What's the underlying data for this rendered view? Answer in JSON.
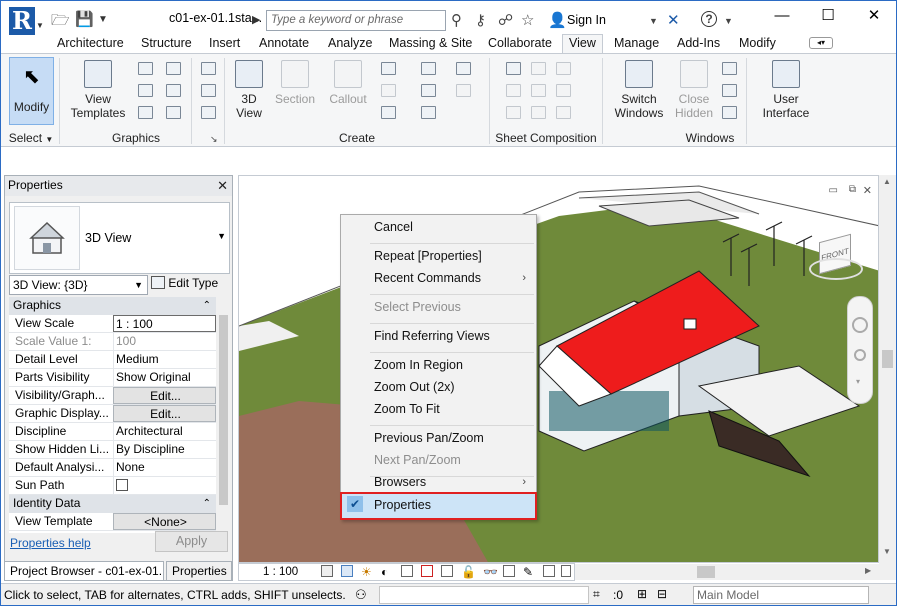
{
  "titlebar": {
    "doc_title": "c01-ex-01.1sta...",
    "search_placeholder": "Type a keyword or phrase",
    "sign_in": "Sign In",
    "help": "?",
    "minimize": "—",
    "maximize": "☐",
    "close": "✕"
  },
  "app_menu": {
    "logo": "R",
    "sub": "A"
  },
  "ribbon_tabs": [
    "Architecture",
    "Structure",
    "Insert",
    "Annotate",
    "Analyze",
    "Massing & Site",
    "Collaborate",
    "View",
    "Manage",
    "Add-Ins",
    "Modify"
  ],
  "active_tab": "View",
  "ribbon": {
    "modify_label": "Modify",
    "select_label": "Select",
    "view_templates": [
      "View",
      "Templates"
    ],
    "graphics_label": "Graphics",
    "view_3d": [
      "3D",
      "View"
    ],
    "section": "Section",
    "callout": "Callout",
    "create_label": "Create",
    "sheet_composition_label": "Sheet Composition",
    "switch_windows": [
      "Switch",
      "Windows"
    ],
    "close_hidden": [
      "Close",
      "Hidden"
    ],
    "user_interface": [
      "User",
      "Interface"
    ],
    "windows_label": "Windows"
  },
  "properties": {
    "header": "Properties",
    "type_name": "3D View",
    "instance_selector": "3D View: {3D}",
    "edit_type": "Edit Type",
    "groups": {
      "graphics": "Graphics",
      "identity": "Identity Data"
    },
    "rows": [
      {
        "k": "View Scale",
        "v": "1 : 100"
      },
      {
        "k": "Scale Value    1:",
        "v": "100"
      },
      {
        "k": "Detail Level",
        "v": "Medium"
      },
      {
        "k": "Parts Visibility",
        "v": "Show Original"
      },
      {
        "k": "Visibility/Graph...",
        "v": "Edit..."
      },
      {
        "k": "Graphic Display...",
        "v": "Edit..."
      },
      {
        "k": "Discipline",
        "v": "Architectural"
      },
      {
        "k": "Show Hidden Li...",
        "v": "By Discipline"
      },
      {
        "k": "Default Analysi...",
        "v": "None"
      },
      {
        "k": "Sun Path",
        "v": ""
      }
    ],
    "identity_rows": [
      {
        "k": "View Template",
        "v": "<None>"
      }
    ],
    "help_link": "Properties help",
    "apply": "Apply"
  },
  "browser_tabs": [
    "Project Browser - c01-ex-01...",
    "Properties"
  ],
  "context_menu": [
    {
      "label": "Cancel",
      "enabled": true
    },
    {
      "label": "Repeat [Properties]",
      "enabled": true
    },
    {
      "label": "Recent Commands",
      "enabled": true,
      "submenu": true
    },
    {
      "label": "Select Previous",
      "enabled": false
    },
    {
      "label": "Find Referring Views",
      "enabled": true
    },
    {
      "label": "Zoom In Region",
      "enabled": true
    },
    {
      "label": "Zoom Out (2x)",
      "enabled": true
    },
    {
      "label": "Zoom To Fit",
      "enabled": true
    },
    {
      "label": "Previous Pan/Zoom",
      "enabled": true
    },
    {
      "label": "Next Pan/Zoom",
      "enabled": false
    },
    {
      "label": "Browsers",
      "enabled": true,
      "submenu": true
    },
    {
      "label": "Properties",
      "enabled": true,
      "checked": true
    }
  ],
  "view_bar": {
    "scale": "1 : 100"
  },
  "viewcube_label": "FRONT",
  "status": {
    "message": "Click to select, TAB for alternates, CTRL adds, SHIFT unselects.",
    "count": ":0",
    "model": "Main Model"
  },
  "colors": {
    "roof": "#ee1c1c",
    "terrain": "#6f8a3a",
    "soil": "#9a6e5a",
    "accent": "#1c5aa8",
    "highlight": "#e02020"
  }
}
